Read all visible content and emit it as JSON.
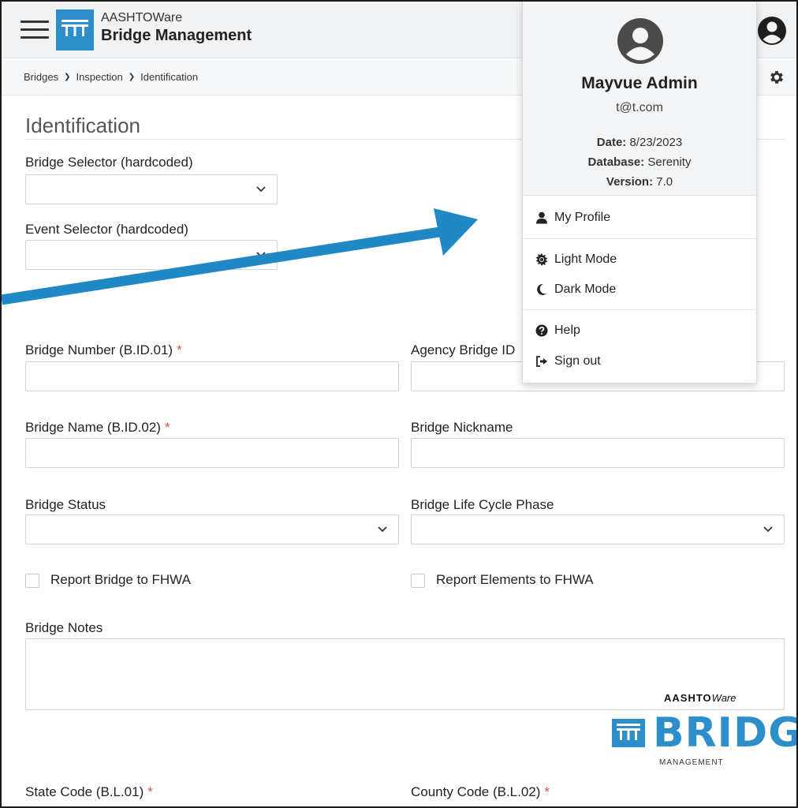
{
  "header": {
    "app_super": "AASHTOWare",
    "app_name": "Bridge Management"
  },
  "breadcrumb": [
    "Bridges",
    "Inspection",
    "Identification"
  ],
  "form": {
    "title": "Identification",
    "bridge_selector_label": "Bridge Selector (hardcoded)",
    "event_selector_label": "Event Selector (hardcoded)",
    "bridge_number_label": "Bridge Number (B.ID.01)",
    "agency_bridge_id_label": "Agency Bridge ID",
    "bridge_name_label": "Bridge Name (B.ID.02)",
    "bridge_nickname_label": "Bridge Nickname",
    "bridge_status_label": "Bridge Status",
    "life_cycle_label": "Bridge Life Cycle Phase",
    "report_bridge_label": "Report Bridge to FHWA",
    "report_elements_label": "Report Elements to FHWA",
    "bridge_notes_label": "Bridge Notes",
    "state_code_label": "State Code (B.L.01)",
    "county_code_label": "County Code (B.L.02)",
    "required_marker": "*"
  },
  "user_menu": {
    "name": "Mayvue Admin",
    "email": "t@t.com",
    "date_label": "Date:",
    "date_value": "8/23/2023",
    "database_label": "Database:",
    "database_value": "Serenity",
    "version_label": "Version:",
    "version_value": "7.0",
    "items": {
      "profile": "My Profile",
      "light_mode": "Light Mode",
      "dark_mode": "Dark Mode",
      "help": "Help",
      "sign_out": "Sign out"
    }
  },
  "bottom_logo": {
    "aashto": "AASHTO",
    "ware": "Ware",
    "bridge": "BRIDG",
    "management": "MANAGEMENT"
  },
  "colors": {
    "brand_blue": "#2c8fc9",
    "arrow_blue": "#1f88c5",
    "required_red": "#d9534f"
  }
}
